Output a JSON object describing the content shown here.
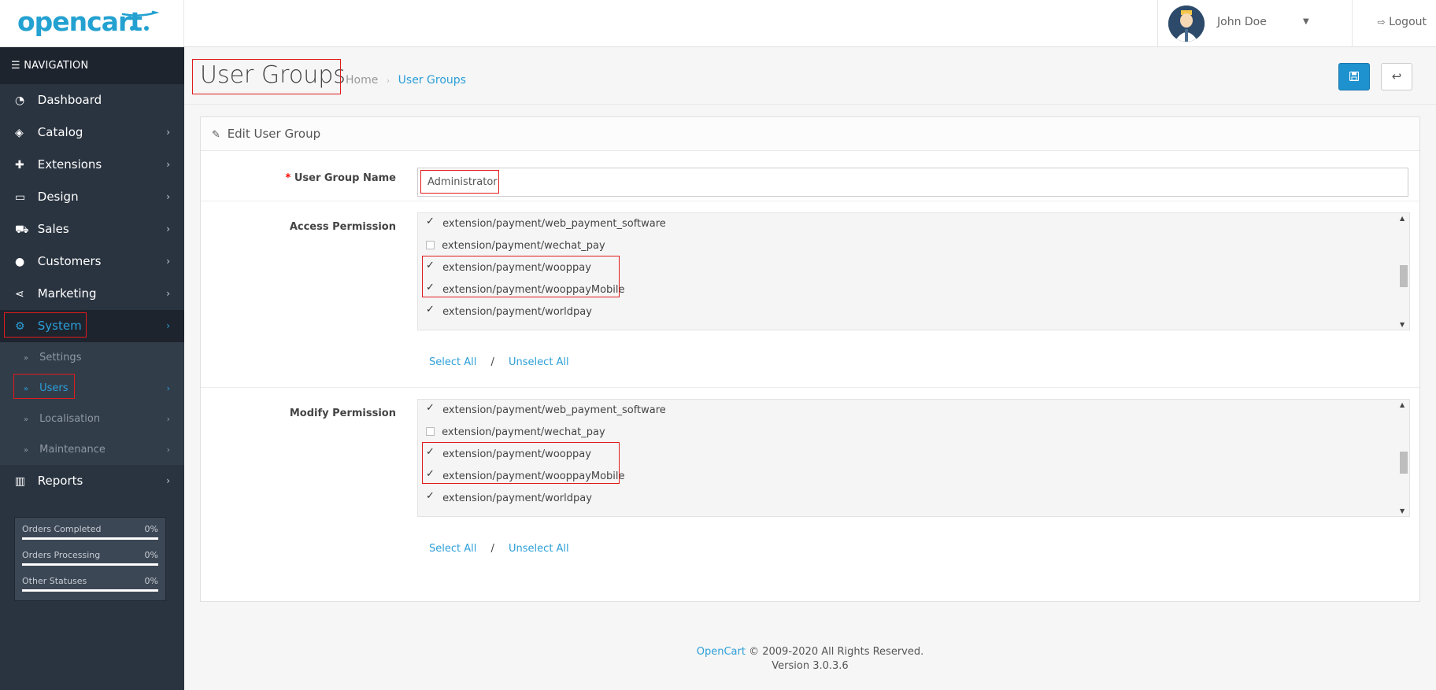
{
  "header": {
    "logo_text": "opencart",
    "user_name": "John Doe",
    "logout_label": "Logout"
  },
  "sidebar": {
    "heading": "NAVIGATION",
    "items": [
      {
        "label": "Dashboard",
        "icon": "dashboard-icon"
      },
      {
        "label": "Catalog",
        "icon": "tags-icon"
      },
      {
        "label": "Extensions",
        "icon": "puzzle-icon"
      },
      {
        "label": "Design",
        "icon": "monitor-icon"
      },
      {
        "label": "Sales",
        "icon": "cart-icon"
      },
      {
        "label": "Customers",
        "icon": "user-icon"
      },
      {
        "label": "Marketing",
        "icon": "share-icon"
      },
      {
        "label": "System",
        "icon": "gear-icon"
      },
      {
        "label": "Reports",
        "icon": "bar-chart-icon"
      }
    ],
    "system_sub": [
      {
        "label": "Settings"
      },
      {
        "label": "Users"
      },
      {
        "label": "Localisation"
      },
      {
        "label": "Maintenance"
      }
    ],
    "stats": [
      {
        "label": "Orders Completed",
        "pct": "0%"
      },
      {
        "label": "Orders Processing",
        "pct": "0%"
      },
      {
        "label": "Other Statuses",
        "pct": "0%"
      }
    ]
  },
  "page": {
    "title": "User Groups",
    "breadcrumb": {
      "home": "Home",
      "current": "User Groups"
    }
  },
  "panel": {
    "heading": "Edit User Group",
    "name_label": "User Group Name",
    "name_value": "Administrator",
    "access_label": "Access Permission",
    "modify_label": "Modify Permission",
    "select_all": "Select All",
    "slash": "/",
    "unselect_all": "Unselect All",
    "permissions": [
      {
        "label": "extension/payment/web_payment_software",
        "checked": true
      },
      {
        "label": "extension/payment/wechat_pay",
        "checked": false
      },
      {
        "label": "extension/payment/wooppay",
        "checked": true
      },
      {
        "label": "extension/payment/wooppayMobile",
        "checked": true
      },
      {
        "label": "extension/payment/worldpay",
        "checked": true
      }
    ]
  },
  "footer": {
    "brand": "OpenCart",
    "copyright": " © 2009-2020 All Rights Reserved.",
    "version": "Version 3.0.3.6"
  },
  "colors": {
    "accent": "#2c9fd8",
    "sidebar_bg": "#2a3440",
    "highlight_box": "#e01b1b"
  }
}
